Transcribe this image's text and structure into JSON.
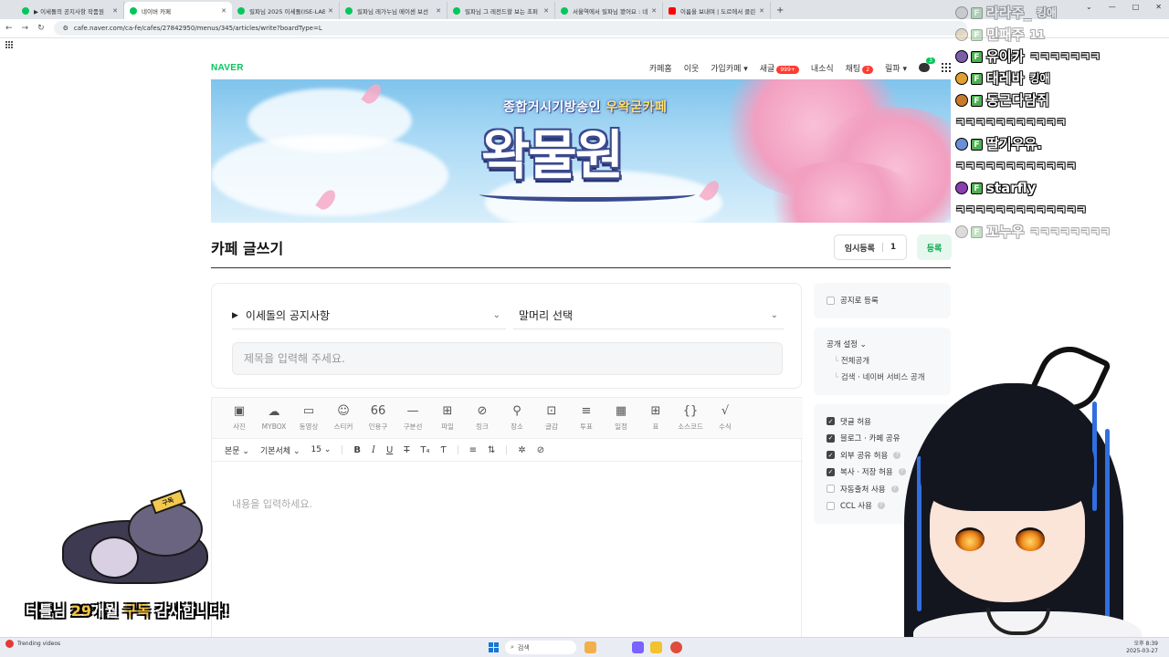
{
  "browser": {
    "tabs": [
      {
        "label": "▶ 이세돌의 공지사항 작품원",
        "active": false
      },
      {
        "label": "네이버 카페",
        "active": true
      },
      {
        "label": "릴파님 2025 이세돌(ISE-LAB)",
        "active": false
      },
      {
        "label": "릴파님 레가누님 메이센 보선",
        "active": false
      },
      {
        "label": "릴파님 그 레전드할 보는 초퍼",
        "active": false
      },
      {
        "label": "서울역에서 릴파님 봤어요 : 네",
        "active": false
      },
      {
        "label": "이름을 보내며 | 도르에서 클린",
        "active": false
      }
    ],
    "new_tab": "+",
    "window_controls": [
      "⌄",
      "—",
      "□",
      "✕"
    ],
    "url": "cafe.naver.com/ca-fe/cafes/27842950/menus/345/articles/write?boardType=L"
  },
  "gnb": {
    "logo": "NAVER",
    "menu": [
      {
        "label": "카페홈"
      },
      {
        "label": "이웃"
      },
      {
        "label": "가입카페 ▾"
      },
      {
        "label": "새글",
        "badge": "999+"
      },
      {
        "label": "내소식"
      },
      {
        "label": "채팅",
        "badge": "2"
      },
      {
        "label": "릴파 ▾"
      }
    ],
    "chat_badge": "3"
  },
  "banner": {
    "subtitle_prefix": "종합거시기방송인",
    "subtitle_accent": "우왁굳카페",
    "title": "왁물원"
  },
  "editor_header": {
    "title": "카페 글쓰기",
    "temp_save_label": "임시등록",
    "temp_save_count": "1",
    "register_label": "등록"
  },
  "form": {
    "board": "이세돌의 공지사항",
    "board_marker": "▶",
    "head": "말머리 선택",
    "title_placeholder": "제목을 입력해 주세요."
  },
  "toolbar": [
    {
      "icon": "photo-icon",
      "glyph": "▣",
      "label": "사진"
    },
    {
      "icon": "mybox-icon",
      "glyph": "☁",
      "label": "MYBOX"
    },
    {
      "icon": "video-icon",
      "glyph": "▭",
      "label": "동영상"
    },
    {
      "icon": "sticker-icon",
      "glyph": "☺",
      "label": "스티커"
    },
    {
      "icon": "quote-icon",
      "glyph": "66",
      "label": "인용구"
    },
    {
      "icon": "divider-icon",
      "glyph": "—",
      "label": "구분선"
    },
    {
      "icon": "file-icon",
      "glyph": "⊞",
      "label": "파일"
    },
    {
      "icon": "link-icon",
      "glyph": "⊘",
      "label": "링크"
    },
    {
      "icon": "place-icon",
      "glyph": "⚲",
      "label": "장소"
    },
    {
      "icon": "post-icon",
      "glyph": "⊡",
      "label": "글감"
    },
    {
      "icon": "vote-icon",
      "glyph": "≡",
      "label": "투표"
    },
    {
      "icon": "schedule-icon",
      "glyph": "▦",
      "label": "일정"
    },
    {
      "icon": "table-icon",
      "glyph": "⊞",
      "label": "표"
    },
    {
      "icon": "code-icon",
      "glyph": "{}",
      "label": "소스코드"
    },
    {
      "icon": "formula-icon",
      "glyph": "√",
      "label": "수식"
    }
  ],
  "format": {
    "paragraph": "본문",
    "font": "기본서체",
    "size": "15"
  },
  "body_placeholder": "내용을 입력하세요.",
  "side": {
    "notice_label": "공지로 등록",
    "visibility_title": "공개 설정 ⌄",
    "visibility_options": [
      "전체공개",
      "검색 · 네이버 서비스 공개"
    ],
    "options": [
      {
        "label": "댓글 허용",
        "checked": true
      },
      {
        "label": "블로그 · 카페 공유",
        "checked": true
      },
      {
        "label": "외부 공유 허용",
        "checked": true
      },
      {
        "label": "복사 · 저장 허용",
        "checked": true
      },
      {
        "label": "자동출처 사용",
        "checked": false
      },
      {
        "label": "CCL 사용",
        "checked": false
      }
    ],
    "help_glyph": "?"
  },
  "stream_chat": [
    {
      "name": "라라주_",
      "msg": "킹애",
      "avatar_color": "#9e9e9e",
      "fade": true
    },
    {
      "name": "민패주",
      "msg": "11",
      "avatar_color": "#c9a76b",
      "fade": true
    },
    {
      "name": "유이카",
      "msg": "ㅋㅋㅋㅋㅋㅋㅋ",
      "avatar_color": "#7b5ea7",
      "fade": false
    },
    {
      "name": "태레바",
      "msg": "킹애",
      "avatar_color": "#e0a030",
      "fade": false
    },
    {
      "name": "동근다람쥐",
      "msg": "ㅋㅋㅋㅋㅋㅋㅋㅋㅋㅋㅋ",
      "avatar_color": "#c77a2e",
      "fade": false
    },
    {
      "name": "딸기우유.",
      "msg": "ㅋㅋㅋㅋㅋㅋㅋㅋㅋㅋㅋㅋ",
      "avatar_color": "#6b8fd6",
      "fade": false
    },
    {
      "name": "starfly",
      "msg": "ㅋㅋㅋㅋㅋㅋㅋㅋㅋㅋㅋㅋㅋ",
      "avatar_color": "#8a3fb0",
      "fade": false
    },
    {
      "name": "꼬누우",
      "msg": "ㅋㅋㅋㅋㅋㅋㅋㅋ",
      "avatar_color": "#9e9e9e",
      "fade": true
    }
  ],
  "sub_alert": {
    "tag": "구독",
    "prefix": "터틀님 ",
    "months": "29",
    "middle": "개월 ",
    "word": "구독",
    "suffix": " 감사합니다!"
  },
  "taskbar": {
    "weather_title": "Trending videos",
    "search_placeholder": "검색",
    "time": "오후 8:39",
    "date": "2025-03-27"
  }
}
